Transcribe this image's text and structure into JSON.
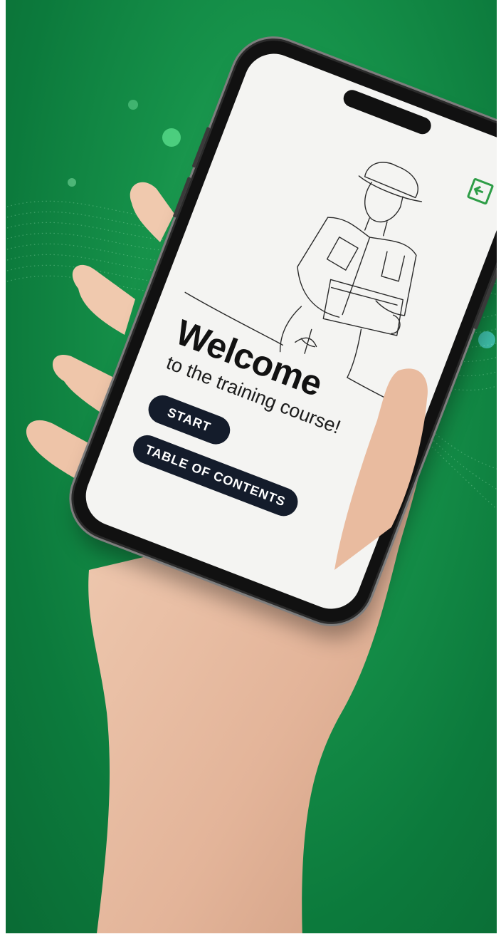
{
  "app": {
    "title": "Welcome",
    "subtitle": "to the training course!"
  },
  "buttons": {
    "start_label": "START",
    "toc_label": "TABLE OF CONTENTS"
  },
  "icons": {
    "exit": "exit-icon",
    "illustration": "construction-worker-illustration"
  },
  "colors": {
    "background_green": "#16924a",
    "button_navy": "#141c2b",
    "exit_icon_green": "#2e9d47",
    "screen_white": "#f4f4f2"
  }
}
